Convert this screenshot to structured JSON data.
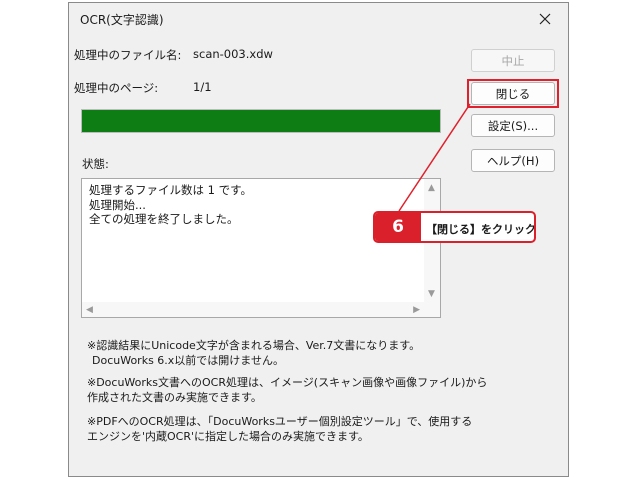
{
  "dialog": {
    "title": "OCR(文字認識)",
    "processing_file_label": "処理中のファイル名:",
    "processing_file_value": "scan-003.xdw",
    "processing_page_label": "処理中のページ:",
    "processing_page_value": "1/1",
    "progress_fraction": 1.0,
    "status_label": "状態:",
    "status_lines": [
      "処理するファイル数は 1 です。",
      "処理開始...",
      "全ての処理を終了しました。"
    ],
    "buttons": {
      "stop": "中止",
      "close": "閉じる",
      "settings": "設定(S)...",
      "help": "ヘルプ(H)"
    },
    "notes": [
      "※認識結果にUnicode文字が含まれる場合、Ver.7文書になります。",
      "DocuWorks 6.x以前では開けません。",
      "※DocuWorks文書へのOCR処理は、イメージ(スキャン画像や画像ファイル)から",
      "作成された文書のみ実施できます。",
      "※PDFへのOCR処理は、「DocuWorksユーザー個別設定ツール」で、使用する",
      "エンジンを'内蔵OCR'に指定した場合のみ実施できます。"
    ]
  },
  "annotation": {
    "step_number": "6",
    "text": "【閉じる】をクリック",
    "color": "#d9202b"
  },
  "colors": {
    "progress": "#0e7d14",
    "dialog_bg": "#f0f0f0"
  }
}
